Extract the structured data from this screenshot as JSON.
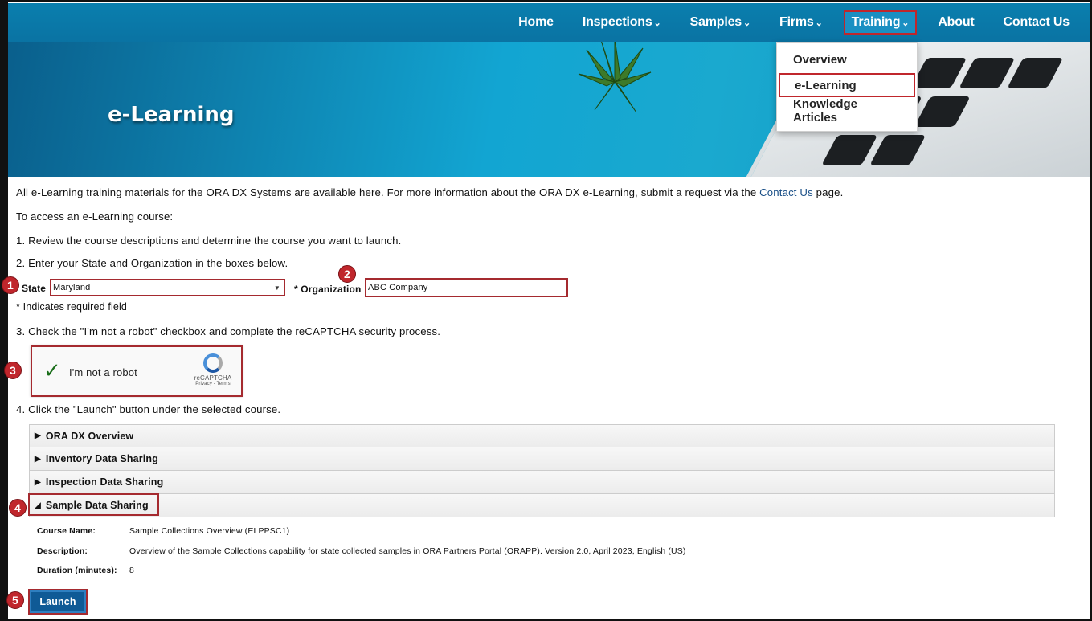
{
  "nav": {
    "items": [
      {
        "label": "Home",
        "caret": false
      },
      {
        "label": "Inspections",
        "caret": true
      },
      {
        "label": "Samples",
        "caret": true
      },
      {
        "label": "Firms",
        "caret": true
      },
      {
        "label": "Training",
        "caret": true,
        "active": true
      },
      {
        "label": "About",
        "caret": false
      },
      {
        "label": "Contact Us",
        "caret": false
      }
    ],
    "caret_glyph": "⌄"
  },
  "hero": {
    "title": "e-Learning"
  },
  "dropdown": {
    "items": [
      "Overview",
      "e-Learning",
      "Knowledge Articles"
    ],
    "selected": "e-Learning"
  },
  "intro": {
    "line1_prefix": "All e-Learning training materials for the ORA DX Systems are available here. For more information about the ORA DX e-Learning, submit a request via the ",
    "line1_link": "Contact Us",
    "line1_suffix": " page.",
    "line2": "To access an e-Learning course:",
    "step1": "1. Review the course descriptions and determine the course you want to launch.",
    "step2": "2. Enter your State and Organization in the boxes below.",
    "step3": "3. Check the \"I'm not a robot\" checkbox and complete the reCAPTCHA security process.",
    "step4": "4. Click the \"Launch\" button under the selected course."
  },
  "form": {
    "state_label": "State",
    "state_value": "Maryland",
    "org_label": "* Organization",
    "org_value": "ABC Company",
    "required_note": "* Indicates required field"
  },
  "captcha": {
    "label": "I'm not a robot",
    "brand": "reCAPTCHA",
    "links": "Privacy - Terms"
  },
  "badges": [
    "1",
    "2",
    "3",
    "4",
    "5"
  ],
  "courses": [
    {
      "title": "ORA DX Overview",
      "open": false
    },
    {
      "title": "Inventory Data Sharing",
      "open": false
    },
    {
      "title": "Inspection Data Sharing",
      "open": false
    },
    {
      "title": "Sample Data Sharing",
      "open": true
    }
  ],
  "course_detail": {
    "name_label": "Course Name:",
    "name_value": "Sample Collections Overview (ELPPSC1)",
    "desc_label": "Description:",
    "desc_value": "Overview of the Sample Collections capability for state collected samples in ORA Partners Portal (ORAPP). Version 2.0, April 2023, English (US)",
    "dur_label": "Duration (minutes):",
    "dur_value": "8"
  },
  "launch_label": "Launch",
  "colors": {
    "nav_blue": "#0a7fae",
    "highlight_red": "#c0262c",
    "button_blue": "#0f5a96"
  }
}
